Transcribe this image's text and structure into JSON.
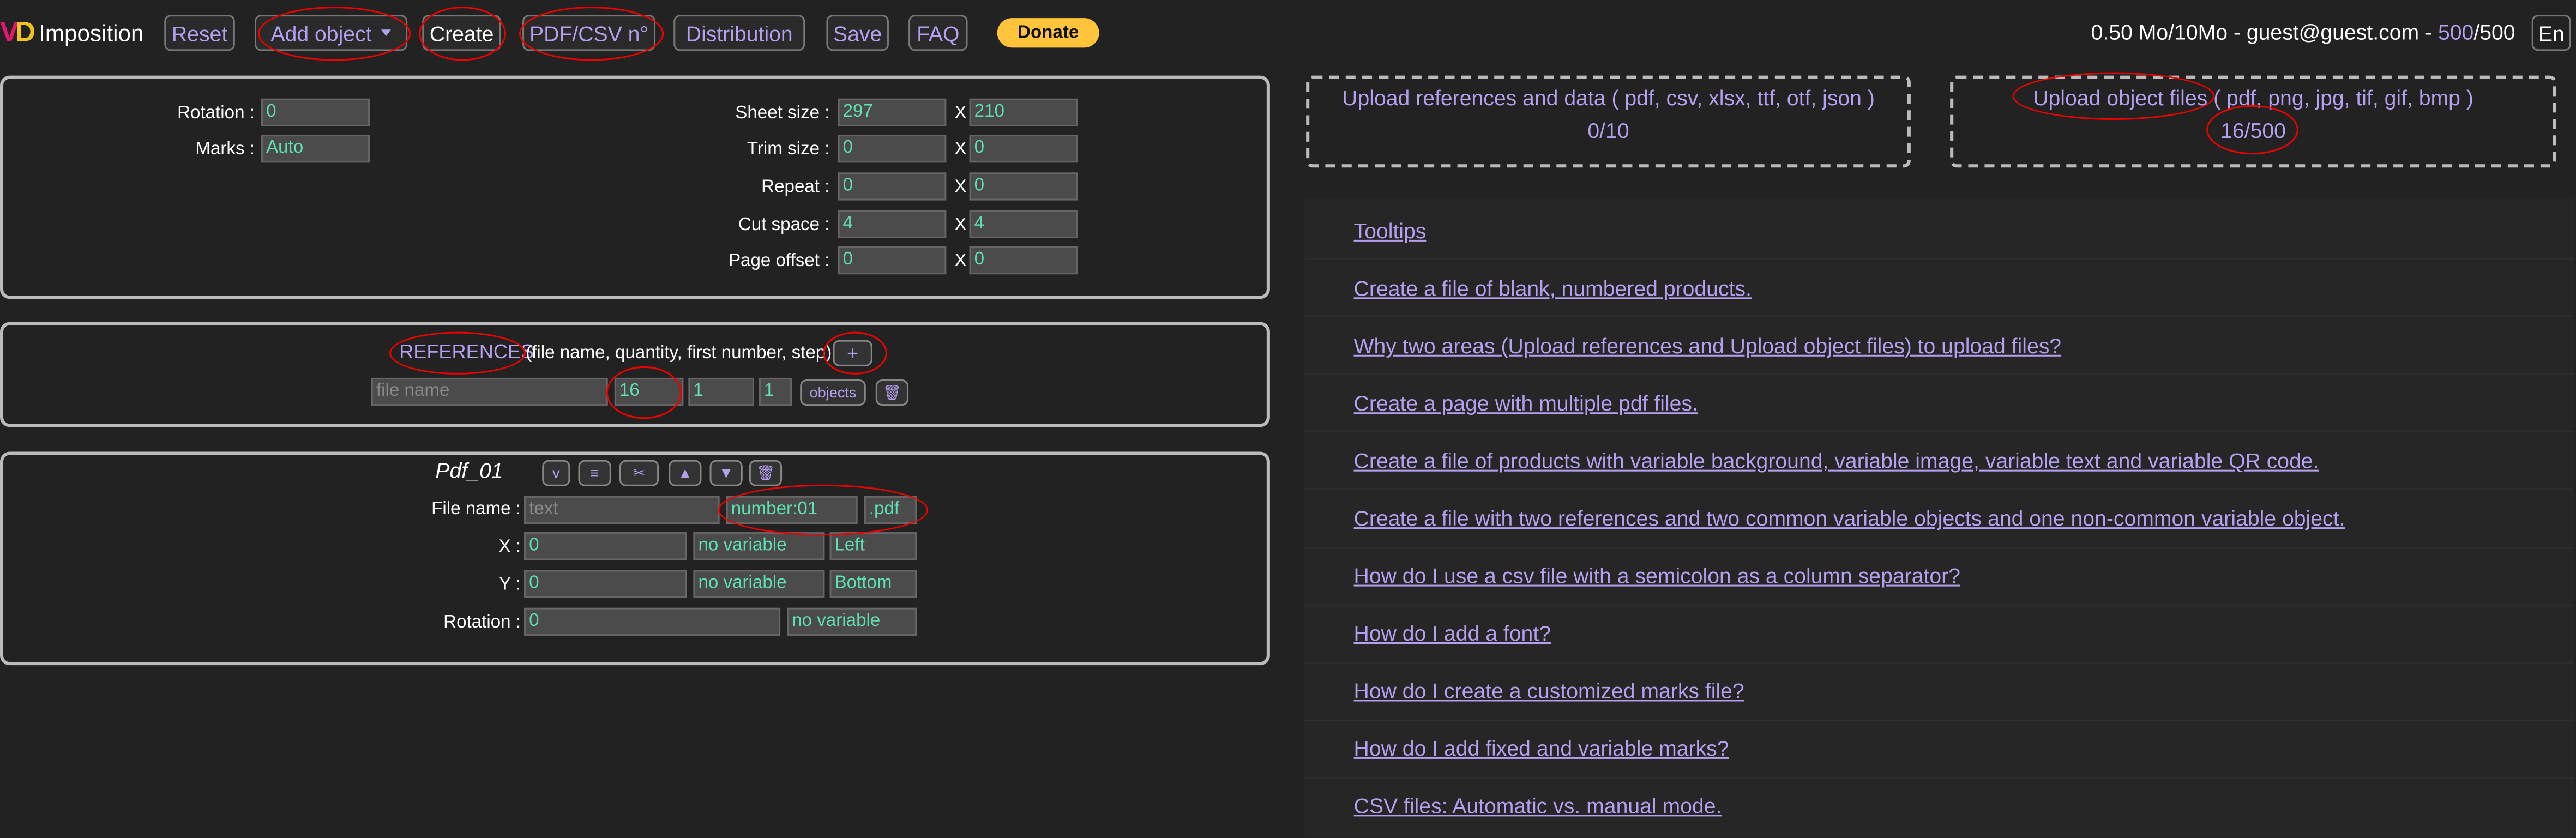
{
  "navbar": {
    "logo_text": "Imposition",
    "buttons": {
      "reset": "Reset",
      "add_object": "Add object",
      "create": "Create",
      "pdf_csv": "PDF/CSV n°",
      "distribution": "Distribution",
      "save": "Save",
      "faq": "FAQ"
    },
    "donate": "Donate",
    "usage": "0.50 Mo/10Mo - guest@guest.com - ",
    "objects_used": "500",
    "objects_total": "/500",
    "language": "En"
  },
  "settings": {
    "rotation_label": "Rotation :",
    "rotation_value": "0",
    "marks_label": "Marks :",
    "marks_value": "Auto",
    "sheet_size_label": "Sheet size :",
    "sheet_size_w": "297",
    "sheet_size_h": "210",
    "trim_size_label": "Trim size :",
    "trim_size_w": "0",
    "trim_size_h": "0",
    "repeat_label": "Repeat :",
    "repeat_w": "0",
    "repeat_h": "0",
    "cut_space_label": "Cut space :",
    "cut_space_w": "4",
    "cut_space_h": "4",
    "page_offset_label": "Page offset :",
    "page_offset_w": "0",
    "page_offset_h": "0",
    "x_sep": "X"
  },
  "references": {
    "title": "REFERENCES",
    "subtitle": "(file name, quantity, first number, step)",
    "add_button": "+",
    "file_name_placeholder": "file name",
    "quantity": "16",
    "first_number": "1",
    "step": "1",
    "objects_button": "objects"
  },
  "pdf_object": {
    "title": "Pdf_01",
    "toolbar": [
      "v",
      "≡",
      "✂",
      "▲",
      "▼",
      "🗑"
    ],
    "file_name_label": "File name :",
    "file_name_placeholder": "text",
    "file_name_variable": "number:01",
    "file_ext": ".pdf",
    "x_label": "X :",
    "x_value": "0",
    "x_variable": "no variable",
    "x_align": "Left",
    "y_label": "Y :",
    "y_value": "0",
    "y_variable": "no variable",
    "y_align": "Bottom",
    "rotation_label": "Rotation :",
    "rotation_value": "0",
    "rotation_variable": "no variable"
  },
  "uploads": {
    "references": {
      "title": "Upload references and data ( pdf, csv, xlsx, ttf, otf, json )",
      "count": "0/10"
    },
    "objects": {
      "title": "Upload object files ( pdf, png, jpg, tif, gif, bmp )",
      "count": "16/500"
    }
  },
  "faq_links": [
    "Tooltips",
    "Create a file of blank, numbered products.",
    "Why two areas (Upload references and Upload object files) to upload files?",
    "Create a page with multiple pdf files.",
    "Create a file of products with variable background, variable image, variable text and variable QR code.",
    "Create a file with two references and two common variable objects and one non-common variable object.",
    "How do I use a csv file with a semicolon as a column separator?",
    "How do I add a font?",
    "How do I create a customized marks file?",
    "How do I add fixed and variable marks?",
    "CSV files: Automatic vs. manual mode."
  ],
  "colors": {
    "accent": "#b4a0ee",
    "field_text": "#5fe0b0",
    "annotation": "#e00000",
    "donate": "#ffc439"
  }
}
